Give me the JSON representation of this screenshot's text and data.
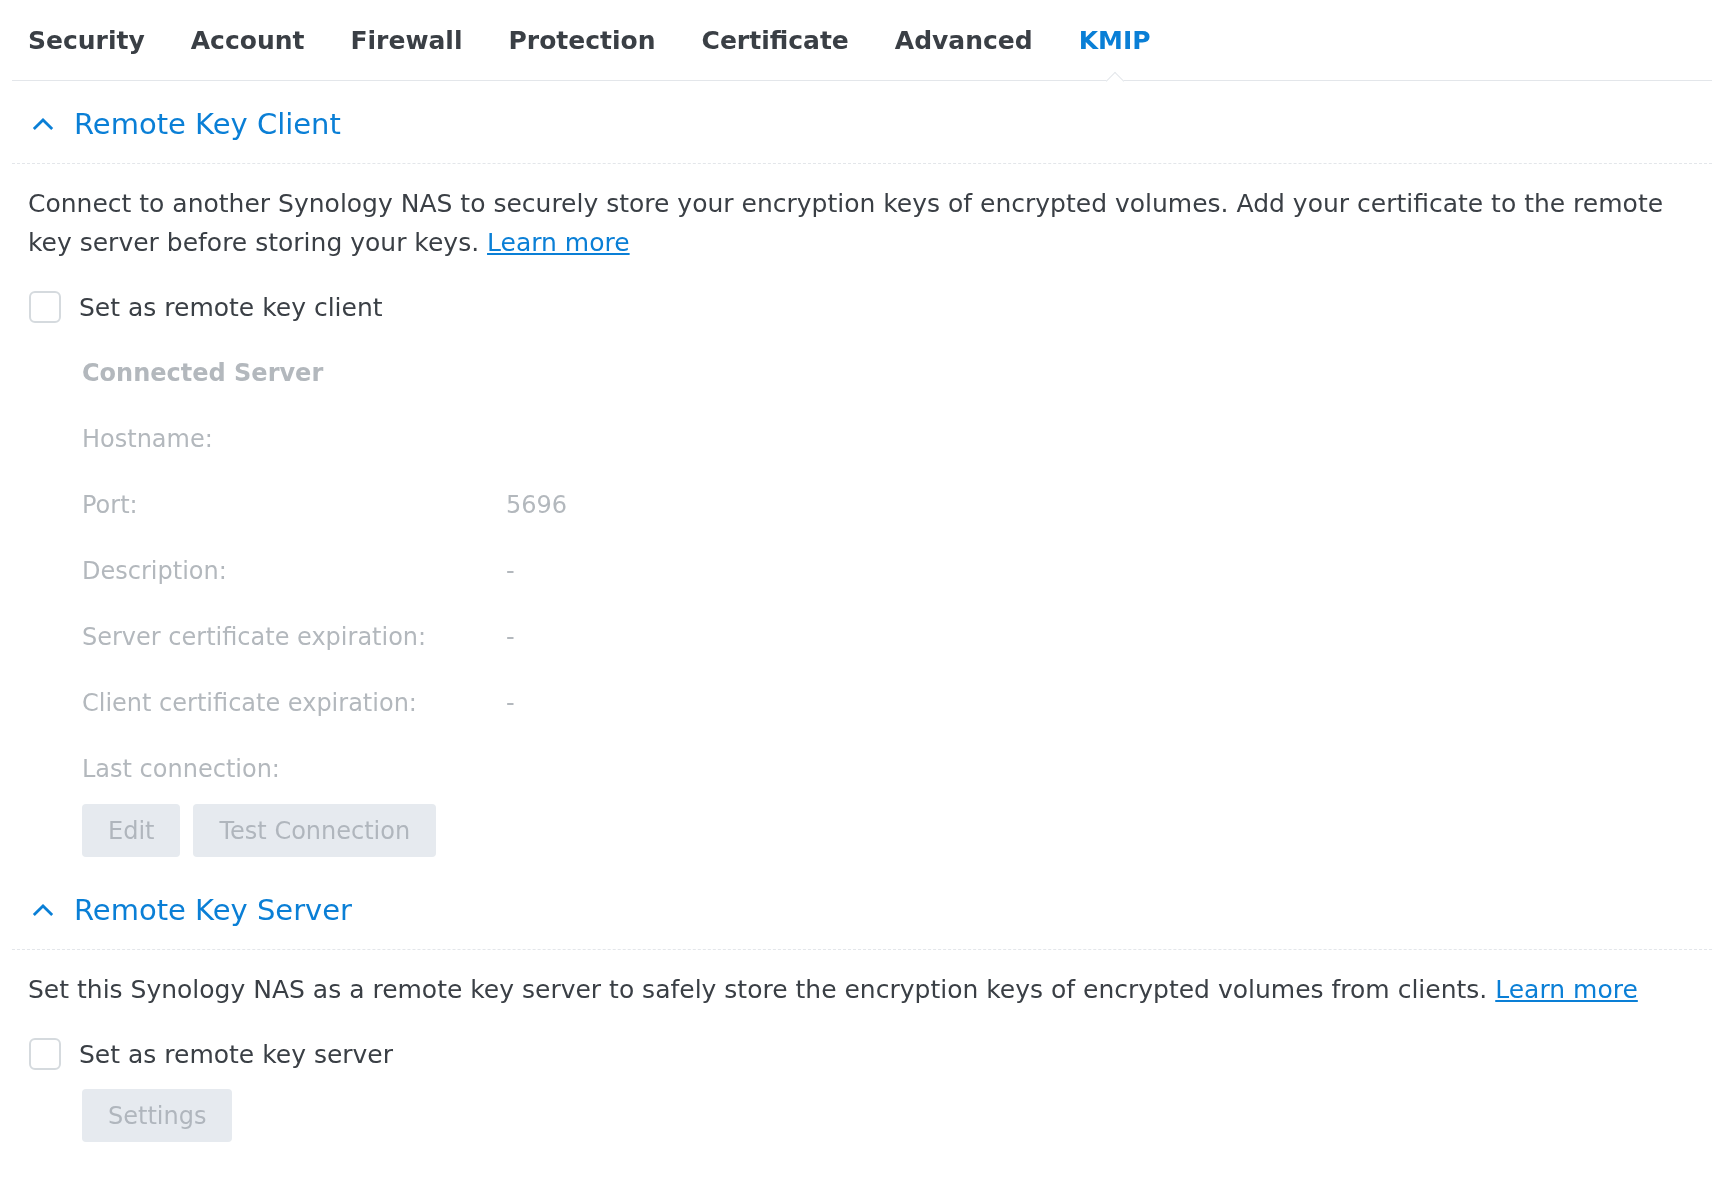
{
  "tabs": [
    {
      "label": "Security",
      "selected": false
    },
    {
      "label": "Account",
      "selected": false
    },
    {
      "label": "Firewall",
      "selected": false
    },
    {
      "label": "Protection",
      "selected": false
    },
    {
      "label": "Certificate",
      "selected": false
    },
    {
      "label": "Advanced",
      "selected": false
    },
    {
      "label": "KMIP",
      "selected": true
    }
  ],
  "sections": [
    {
      "title": "Remote Key Client",
      "expanded": true,
      "description": "Connect to another Synology NAS to securely store your encryption keys of encrypted volumes. Add your certificate to the remote key server before storing your keys.",
      "link": "Learn more",
      "checkbox": {
        "label": "Set as remote key client",
        "checked": false
      },
      "details": {
        "disabled": true,
        "heading": "Connected Server",
        "fields": [
          {
            "label": "Hostname:"
          },
          {
            "label": "Port:",
            "value": "5696"
          },
          {
            "label": "Description:",
            "value": "-"
          },
          {
            "label": "Server certificate expiration:",
            "value": "-"
          },
          {
            "label": "Client certificate expiration:",
            "value": "-"
          },
          {
            "label": "Last connection:"
          }
        ]
      },
      "buttons": [
        {
          "label": "Edit",
          "disabled": true
        },
        {
          "label": "Test Connection",
          "disabled": true
        }
      ]
    },
    {
      "title": "Remote Key Server",
      "expanded": true,
      "description": "Set this Synology NAS as a remote key server to safely store the encryption keys of encrypted volumes from clients.",
      "link": "Learn more",
      "checkbox": {
        "label": "Set as remote key server",
        "checked": false
      },
      "buttons": [
        {
          "label": "Settings",
          "disabled": true
        }
      ]
    }
  ]
}
